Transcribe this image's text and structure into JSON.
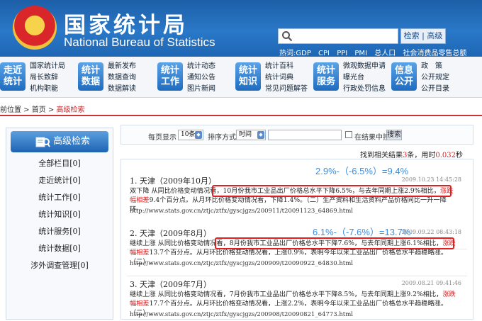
{
  "header": {
    "title_cn": "国家统计局",
    "title_en": "National Bureau of Statistics",
    "search_button": "检索 | 高级",
    "hot_words": [
      "热词:GDP",
      "CPI",
      "PPI",
      "PMI",
      "总人口",
      "社会消费品零售总额"
    ]
  },
  "nav": [
    {
      "tile": "走近统计",
      "links": [
        "国家统计局",
        "局长致辞",
        "机构职能"
      ]
    },
    {
      "tile": "统计数据",
      "links": [
        "最新发布",
        "数据查询",
        "数据解读"
      ]
    },
    {
      "tile": "统计工作",
      "links": [
        "统计动态",
        "通知公告",
        "图片新闻"
      ]
    },
    {
      "tile": "统计知识",
      "links": [
        "统计百科",
        "统计词典",
        "常见问题解答"
      ]
    },
    {
      "tile": "统计服务",
      "links": [
        "微观数据申请",
        "曝光台",
        "行政处罚信息"
      ]
    },
    {
      "tile": "信息公开",
      "links": [
        "政　策",
        "公开规定",
        "公开目录"
      ]
    }
  ],
  "breadcrumb": {
    "prefix": "前位置 > 首页 > ",
    "current": "高级检索"
  },
  "sidebar": {
    "title": "高级检索",
    "items": [
      "全部栏目[0]",
      "走近统计[0]",
      "统计工作[0]",
      "统计知识[0]",
      "统计服务[0]",
      "统计数据[0]",
      "涉外调查管理[0]"
    ]
  },
  "filter": {
    "per_page_label": "每页显示",
    "per_page_value": "10条",
    "sort_label": "排序方式",
    "sort_value": "时间",
    "search_within_label": "在结果中搜索",
    "search_button": "搜索"
  },
  "count": {
    "prefix": "找到相关结果",
    "num": "3",
    "mid": "条，用时",
    "time": "0.032",
    "suffix": "秒"
  },
  "results": [
    {
      "title": "1. 天津（2009年10月）",
      "date": "2009.10.23 14:45:28",
      "formula": "2.9%-（-6.5%）=9.4%",
      "body_a": "双下降 从同比价格变动情况看，10月份我市工业品出厂价格总水平下降6.5%，与去年同期上涨2.9%相比，",
      "body_red": "涨跌幅相差",
      "body_b": "9.4个百分点。从月环比价格变动情况看，下降1.4%。（二）生产资料和生活资料产品价格同比一升一降 环...",
      "url": "http://www.stats.gov.cn/ztjc/ztfx/gyscjgzs/200911/t20091123_64869.html"
    },
    {
      "title": "2. 天津（2009年8月）",
      "date": "2009.09.22 08:43:18",
      "formula": "6.1%-（-7.6%）=13.7%",
      "body_a": "继续上涨 从同比价格变动情况看，8月份我市工业品出厂价格总水平下降7.6%，与去年同期上涨6.1%相比，",
      "body_red": "涨跌幅相差",
      "body_b": "13.7个百分点。从月环比价格变动情况看，上涨0.9%，表明今年以来工业品出厂价格总水平趋稳略涨。（二）...",
      "url": "http://www.stats.gov.cn/ztjc/ztfx/gyscjgzs/200909/t20090922_64830.html"
    },
    {
      "title": "3. 天津（2009年7月）",
      "date": "2009.08.21 09:41:46",
      "body_a": "继续上涨 从同比价格变动情况看，7月份我市工业品出厂价格总水平下降8.5%，与去年同期上涨9.2%相比，",
      "body_red": "涨跌幅相差",
      "body_b": "17.7个百分点。从月环比价格变动情况看，上涨2.2%，表明今年以来工业品出厂价格总水平趋稳略涨。（二）...",
      "url": "http://www.stats.gov.cn/ztjc/ztfx/gyscjgzs/200908/t20090821_64773.html"
    }
  ]
}
